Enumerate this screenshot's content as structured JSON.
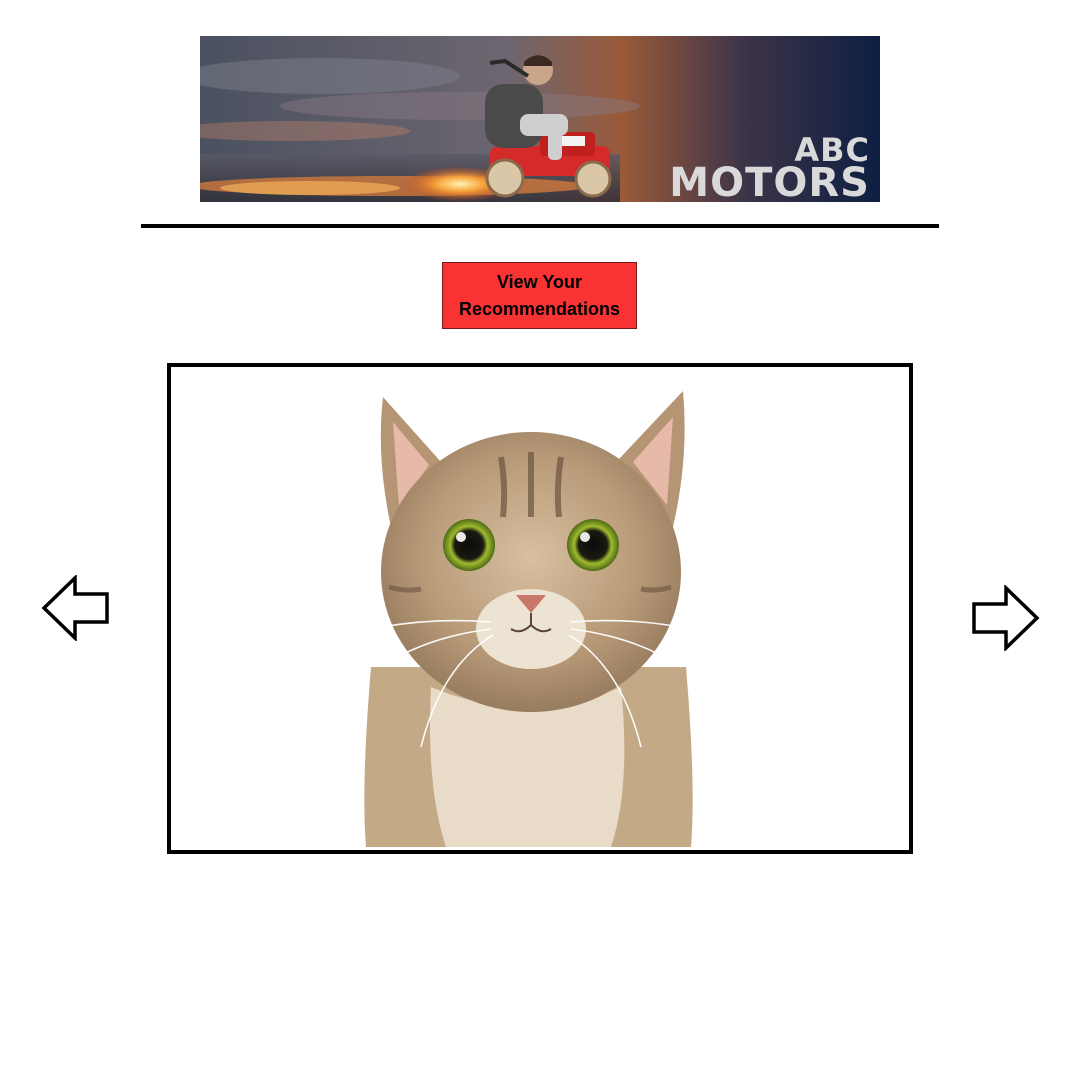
{
  "banner": {
    "brand_line1": "ABC",
    "brand_line2": "MOTORS",
    "colors": {
      "sky_left": "#4c5363",
      "sky_right": "#0e1e3e",
      "glow": "#a05a35",
      "car": "#d42a2a",
      "flames": "#f4a640"
    }
  },
  "actions": {
    "recommendations_line1": "View Your",
    "recommendations_line2": "Recommendations"
  },
  "carousel": {
    "image_subject": "cat-photo",
    "prev_icon": "left-arrow-icon",
    "next_icon": "right-arrow-icon"
  },
  "colors": {
    "button_bg": "#f93333",
    "frame": "#000000",
    "divider": "#000000"
  }
}
